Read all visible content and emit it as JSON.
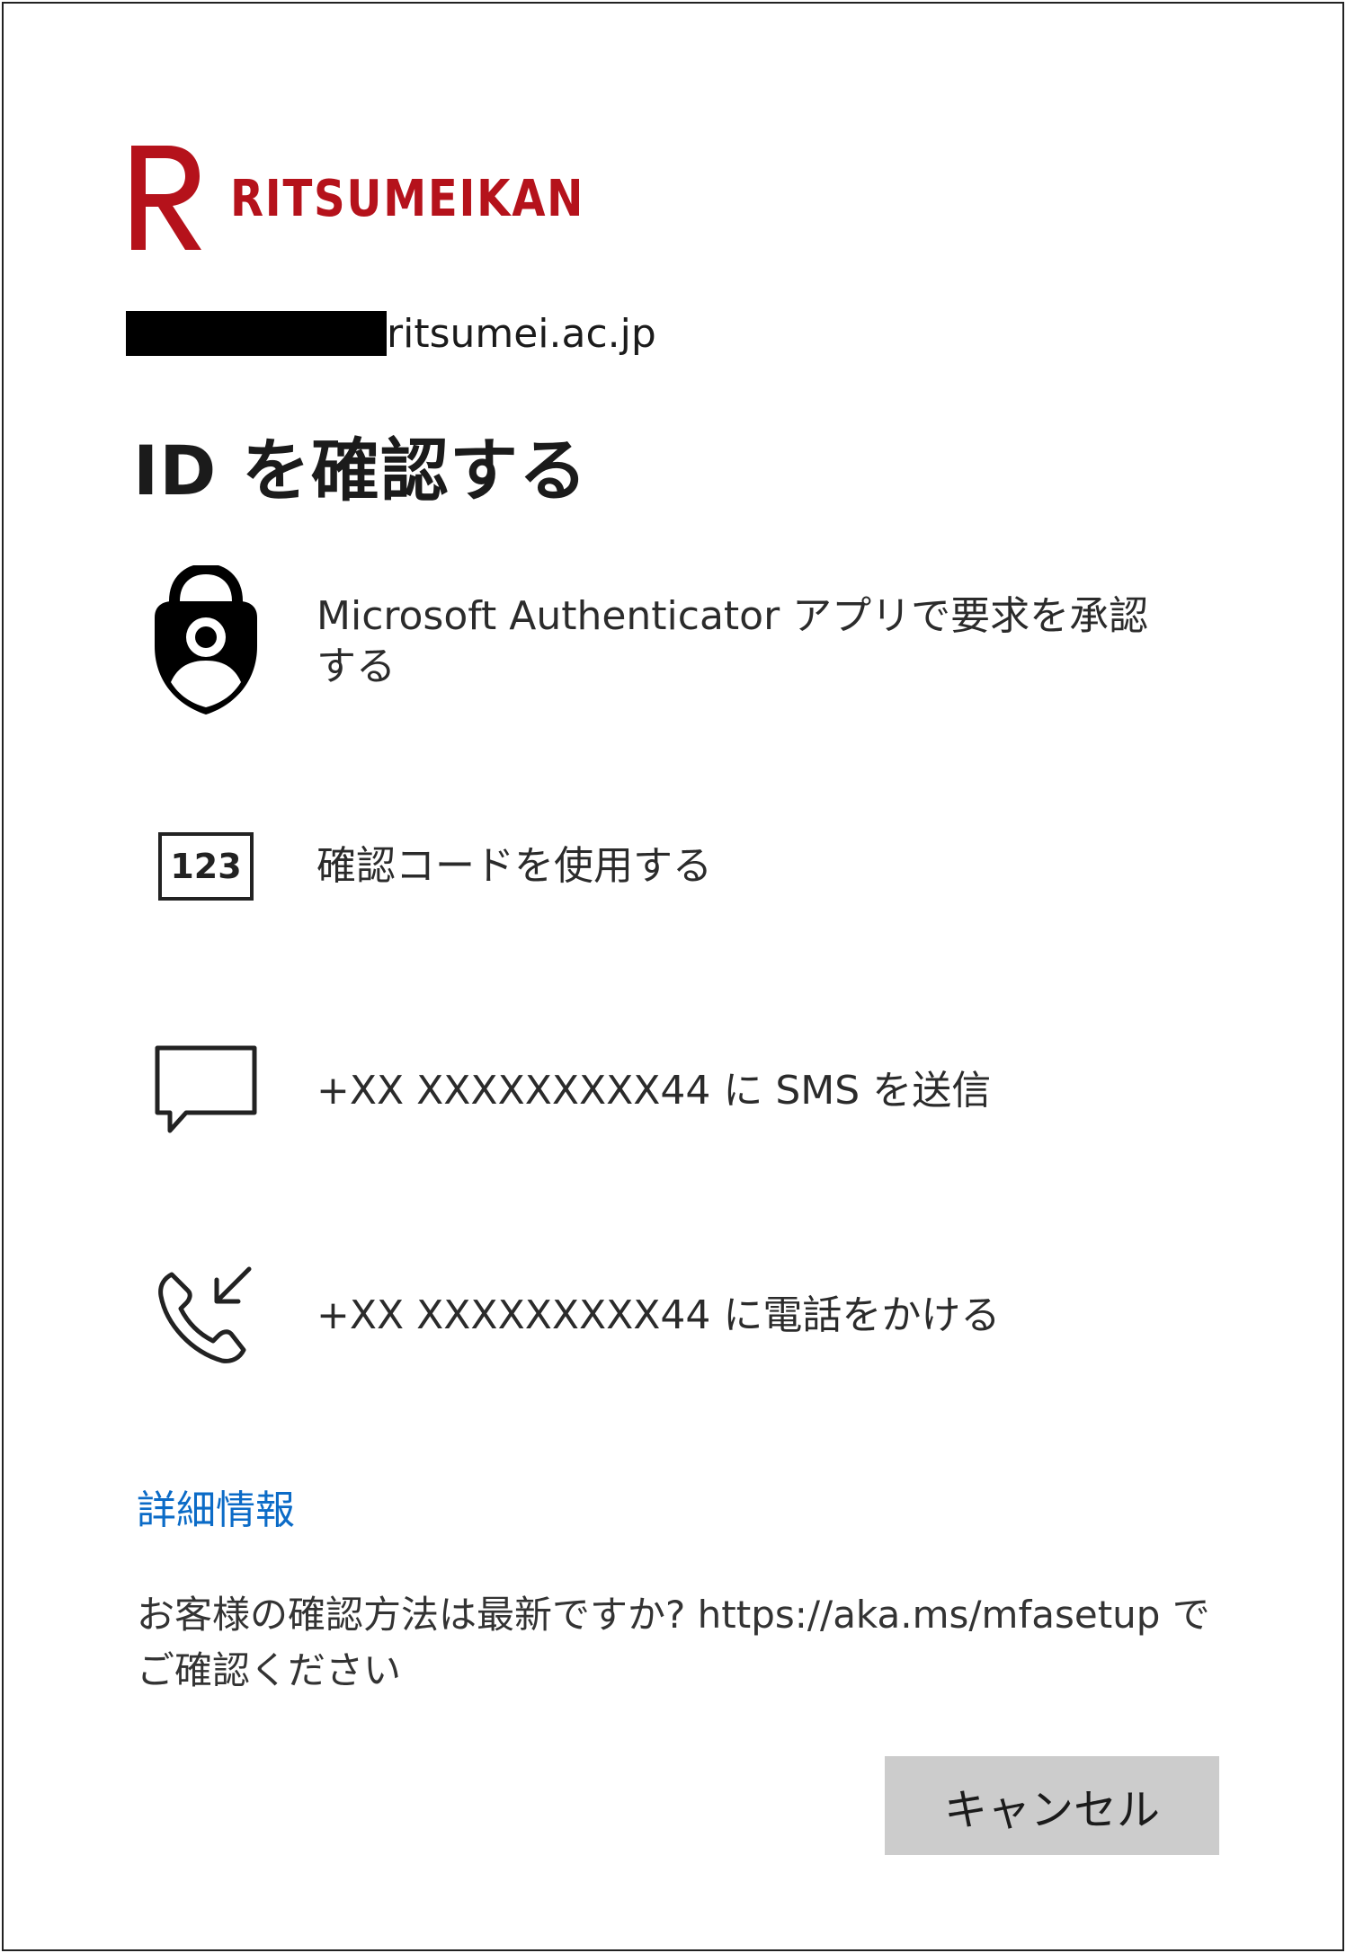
{
  "brand": {
    "name": "RITSUMEIKAN",
    "mark_letter": "R",
    "color": "#b5121b"
  },
  "account": {
    "domain": "ritsumei.ac.jp"
  },
  "title": "ID を確認する",
  "options": [
    {
      "icon": "authenticator-lock-icon",
      "label": "Microsoft Authenticator アプリで要求を承認する"
    },
    {
      "icon": "verification-code-icon",
      "icon_text": "123",
      "label": "確認コードを使用する"
    },
    {
      "icon": "chat-bubble-icon",
      "label": "+XX XXXXXXXXX44 に SMS を送信"
    },
    {
      "icon": "phone-incoming-icon",
      "label": "+XX XXXXXXXXX44 に電話をかける"
    }
  ],
  "more_info": {
    "label": "詳細情報",
    "color": "#0b6bc7"
  },
  "note": "お客様の確認方法は最新ですか? https://aka.ms/mfasetup でご確認ください",
  "cancel_button": {
    "label": "キャンセル"
  }
}
